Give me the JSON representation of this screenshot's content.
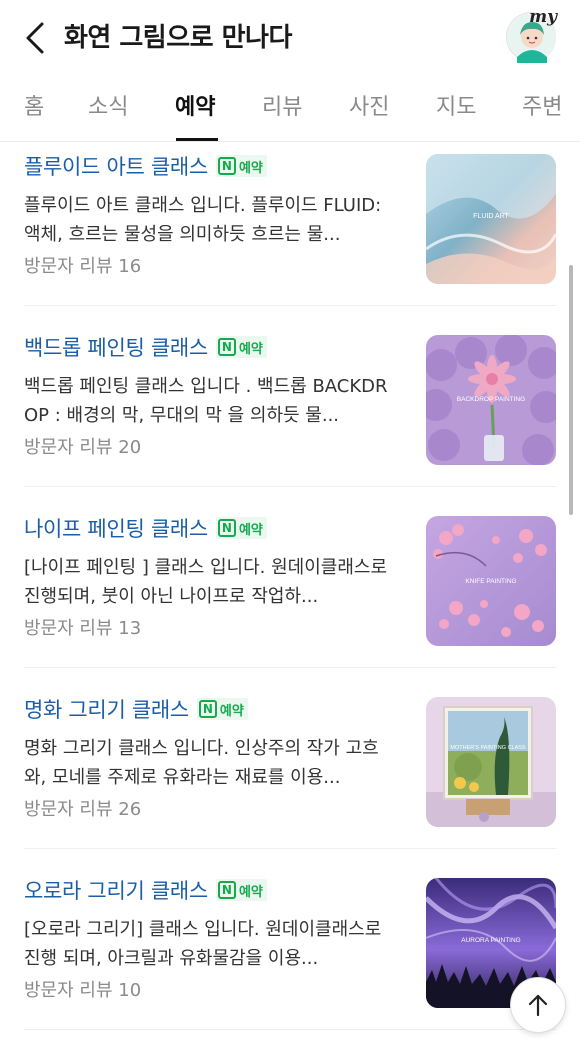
{
  "header": {
    "title": "화연 그림으로 만나다",
    "avatar_badge": "my"
  },
  "tabs": [
    {
      "label": "홈",
      "active": false
    },
    {
      "label": "소식",
      "active": false
    },
    {
      "label": "예약",
      "active": true
    },
    {
      "label": "리뷰",
      "active": false
    },
    {
      "label": "사진",
      "active": false
    },
    {
      "label": "지도",
      "active": false
    },
    {
      "label": "주변",
      "active": false
    }
  ],
  "reservation_badge": {
    "icon": "N",
    "label": "예약",
    "color": "#18a94f"
  },
  "items": [
    {
      "title": "플루이드 아트 클래스",
      "desc": "플루이드 아트 클래스 입니다. 플루이드 FLUID: 액체, 흐르는 물성을 의미하듯 흐르는 물...",
      "reviews": "방문자 리뷰 16",
      "thumb_text": "FLUID ART"
    },
    {
      "title": "백드롭 페인팅 클래스",
      "desc": "백드롭 페인팅 클래스 입니다 . 백드롭 BACKDROP : 배경의 막, 무대의 막 을 의하듯 물...",
      "reviews": "방문자 리뷰 20",
      "thumb_text": "BACKDROP PAINTING"
    },
    {
      "title": "나이프 페인팅 클래스",
      "desc": "[나이프 페인팅 ] 클래스 입니다. 원데이클래스로 진행되며, 붓이 아닌 나이프로 작업하...",
      "reviews": "방문자 리뷰 13",
      "thumb_text": "KNIFE PAINTING"
    },
    {
      "title": "명화 그리기 클래스",
      "desc": "명화 그리기 클래스 입니다. 인상주의 작가 고흐와, 모네를 주제로 유화라는 재료를 이용...",
      "reviews": "방문자 리뷰 26",
      "thumb_text": "MOTHER'S PAINTING CLASS"
    },
    {
      "title": "오로라 그리기 클래스",
      "desc": "[오로라 그리기] 클래스 입니다. 원데이클래스로 진행 되며, 아크릴과 유화물감을 이용...",
      "reviews": "방문자 리뷰 10",
      "thumb_text": "AURORA PAINTING"
    }
  ],
  "colors": {
    "title_link": "#1b5ea8",
    "badge_green": "#18a94f",
    "muted": "#8b8b8b"
  }
}
